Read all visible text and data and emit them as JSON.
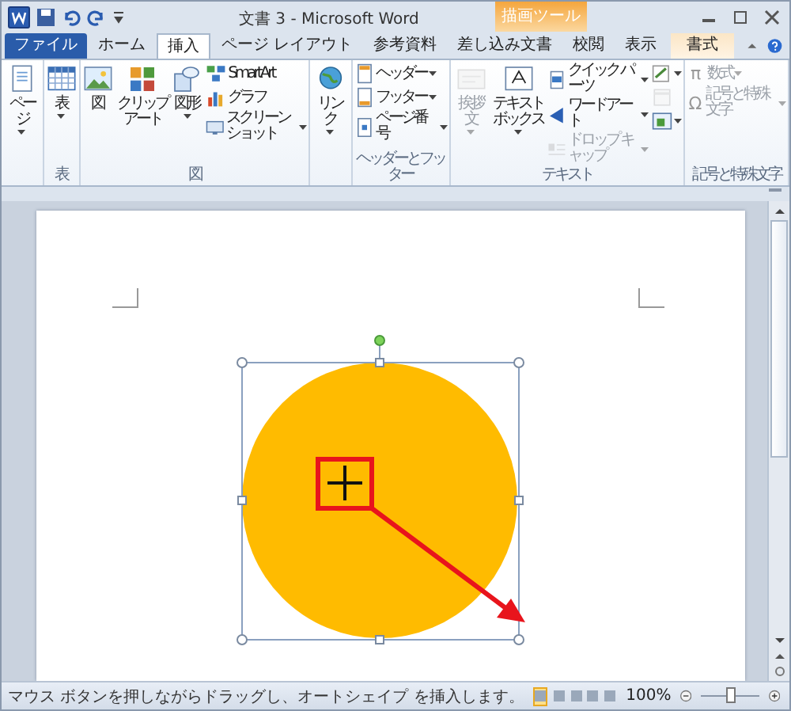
{
  "window": {
    "title": "文書 3 - Microsoft Word"
  },
  "contextual_tab_group": "描画ツール",
  "tabs": [
    {
      "label": "ファイル",
      "kind": "file",
      "selected": false
    },
    {
      "label": "ホーム",
      "kind": "tab",
      "selected": false
    },
    {
      "label": "挿入",
      "kind": "tab",
      "selected": true
    },
    {
      "label": "ページ レイアウト",
      "kind": "tab",
      "selected": false
    },
    {
      "label": "参考資料",
      "kind": "tab",
      "selected": false
    },
    {
      "label": "差し込み文書",
      "kind": "tab",
      "selected": false
    },
    {
      "label": "校閲",
      "kind": "tab",
      "selected": false
    },
    {
      "label": "表示",
      "kind": "tab",
      "selected": false
    },
    {
      "label": "書式",
      "kind": "contextual",
      "selected": false
    }
  ],
  "ribbon_groups": [
    {
      "items": [
        {
          "kind": "large",
          "label": "ページ",
          "dropdown": true,
          "disabled": false
        }
      ]
    },
    {
      "label": "表",
      "items": [
        {
          "kind": "large",
          "label": "表",
          "dropdown": true,
          "disabled": false
        }
      ]
    },
    {
      "label": "図",
      "items": [
        {
          "kind": "large",
          "label": "図",
          "dropdown": false,
          "disabled": false
        },
        {
          "kind": "large",
          "label": "クリップアート",
          "dropdown": false,
          "disabled": false
        },
        {
          "kind": "large",
          "label": "図形",
          "dropdown": true,
          "disabled": false
        },
        {
          "kind": "small",
          "label": "SmartArt",
          "dropdown": false,
          "disabled": false
        },
        {
          "kind": "small",
          "label": "グラフ",
          "dropdown": false,
          "disabled": false
        },
        {
          "kind": "small",
          "label": "スクリーンショット",
          "dropdown": true,
          "disabled": false
        }
      ]
    },
    {
      "items": [
        {
          "kind": "large",
          "label": "リンク",
          "dropdown": true,
          "disabled": false
        }
      ]
    },
    {
      "label": "ヘッダーとフッター",
      "items": [
        {
          "kind": "small",
          "label": "ヘッダー",
          "dropdown": true,
          "disabled": false
        },
        {
          "kind": "small",
          "label": "フッター",
          "dropdown": true,
          "disabled": false
        },
        {
          "kind": "small",
          "label": "ページ番号",
          "dropdown": true,
          "disabled": false
        }
      ]
    },
    {
      "label": "テキスト",
      "items": [
        {
          "kind": "large",
          "label": "挨拶文",
          "dropdown": true,
          "disabled": true
        },
        {
          "kind": "large",
          "label": "テキストボックス",
          "dropdown": true,
          "disabled": false
        },
        {
          "kind": "small",
          "label": "クイック パーツ",
          "dropdown": true,
          "disabled": false
        },
        {
          "kind": "small",
          "label": "ワードアート",
          "dropdown": true,
          "disabled": false
        },
        {
          "kind": "small",
          "label": "ドロップ キャップ",
          "dropdown": true,
          "disabled": true
        },
        {
          "kind": "icon",
          "dropdown": true,
          "disabled": false
        },
        {
          "kind": "icon",
          "dropdown": false,
          "disabled": true
        },
        {
          "kind": "icon",
          "dropdown": true,
          "disabled": false
        }
      ]
    },
    {
      "label": "記号と特殊文字",
      "items": [
        {
          "kind": "small",
          "symbol": "π",
          "label": "数式",
          "dropdown": true,
          "disabled": true
        },
        {
          "kind": "small",
          "symbol": "Ω",
          "label": "記号と特殊文字",
          "dropdown": true,
          "disabled": true
        }
      ]
    }
  ],
  "canvas": {
    "shape": {
      "kind": "ellipse",
      "selected": true
    }
  },
  "status_bar": {
    "message": "マウス ボタンを押しながらドラッグし、オートシェイプ を挿入します。",
    "view_buttons": [
      {
        "selected": true
      },
      {
        "selected": false
      },
      {
        "selected": false
      },
      {
        "selected": false
      },
      {
        "selected": false
      }
    ],
    "zoom": "100%",
    "zoom_slider": {
      "level": 0.5
    }
  }
}
